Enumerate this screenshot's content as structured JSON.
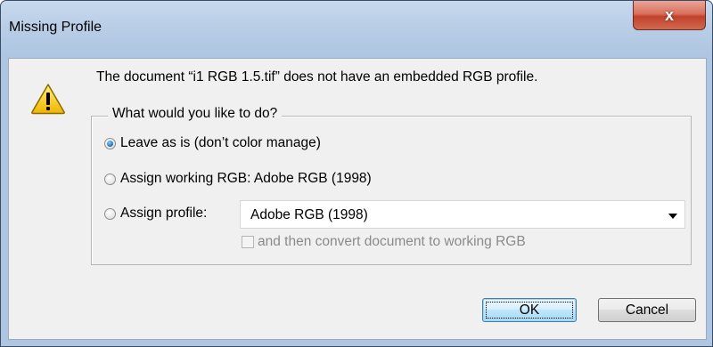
{
  "window": {
    "title": "Missing Profile",
    "close_glyph": "x"
  },
  "icons": {
    "warning": "warning-triangle-icon"
  },
  "message": "The document “i1 RGB 1.5.tif” does not have an embedded RGB profile.",
  "options": {
    "legend": "What would you like to do?",
    "radios": [
      {
        "label": "Leave as is (don’t color manage)",
        "checked": true
      },
      {
        "label": "Assign working RGB:  Adobe RGB (1998)",
        "checked": false
      },
      {
        "label": "Assign profile:",
        "checked": false
      }
    ],
    "profile_select": {
      "value": "Adobe RGB (1998)"
    },
    "convert_checkbox": {
      "label": "and then convert document to working RGB",
      "checked": false,
      "enabled": false
    }
  },
  "buttons": {
    "ok": "OK",
    "cancel": "Cancel"
  },
  "colors": {
    "title_bar": "#b9cde6",
    "close_button": "#c2412b",
    "dialog_background": "#f0f0f0",
    "default_button": "#bee6fd"
  }
}
